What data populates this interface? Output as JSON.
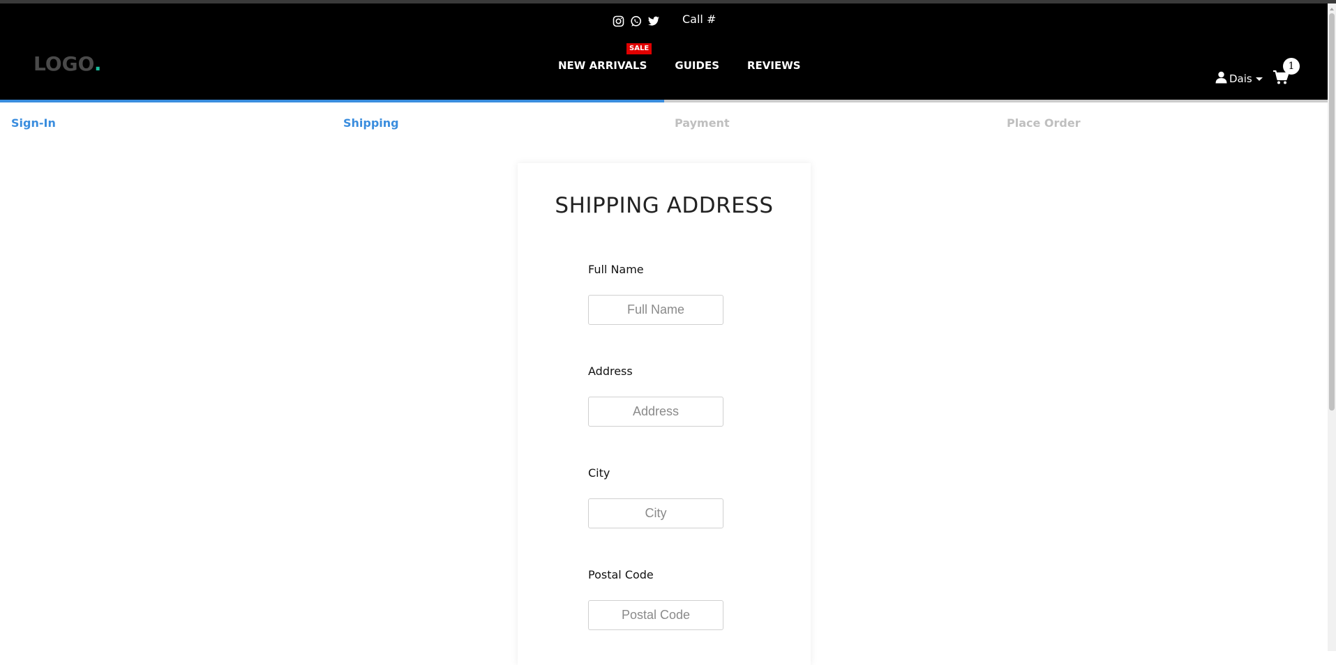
{
  "header": {
    "call_label": "Call #",
    "logo_text": "LOGO",
    "logo_dot": ".",
    "nav": [
      {
        "label": "NEW ARRIVALS",
        "badge": "SALE"
      },
      {
        "label": "GUIDES"
      },
      {
        "label": "REVIEWS"
      }
    ],
    "user_name": "Dais",
    "cart_count": "1"
  },
  "checkout_steps": {
    "progress_fraction": 0.5,
    "steps": [
      {
        "label": "Sign-In",
        "active": true
      },
      {
        "label": "Shipping",
        "active": true
      },
      {
        "label": "Payment",
        "active": false
      },
      {
        "label": "Place Order",
        "active": false
      }
    ]
  },
  "form": {
    "title": "SHIPPING ADDRESS",
    "fields": [
      {
        "label": "Full Name",
        "placeholder": "Full Name",
        "value": ""
      },
      {
        "label": "Address",
        "placeholder": "Address",
        "value": ""
      },
      {
        "label": "City",
        "placeholder": "City",
        "value": ""
      },
      {
        "label": "Postal Code",
        "placeholder": "Postal Code",
        "value": ""
      }
    ]
  },
  "colors": {
    "accent": "#3a8dde",
    "sale": "#e00000",
    "header_bg": "#000000",
    "logo_dot": "#1abc9c"
  },
  "icons": [
    "instagram-icon",
    "whatsapp-icon",
    "twitter-icon",
    "user-icon",
    "cart-icon"
  ]
}
